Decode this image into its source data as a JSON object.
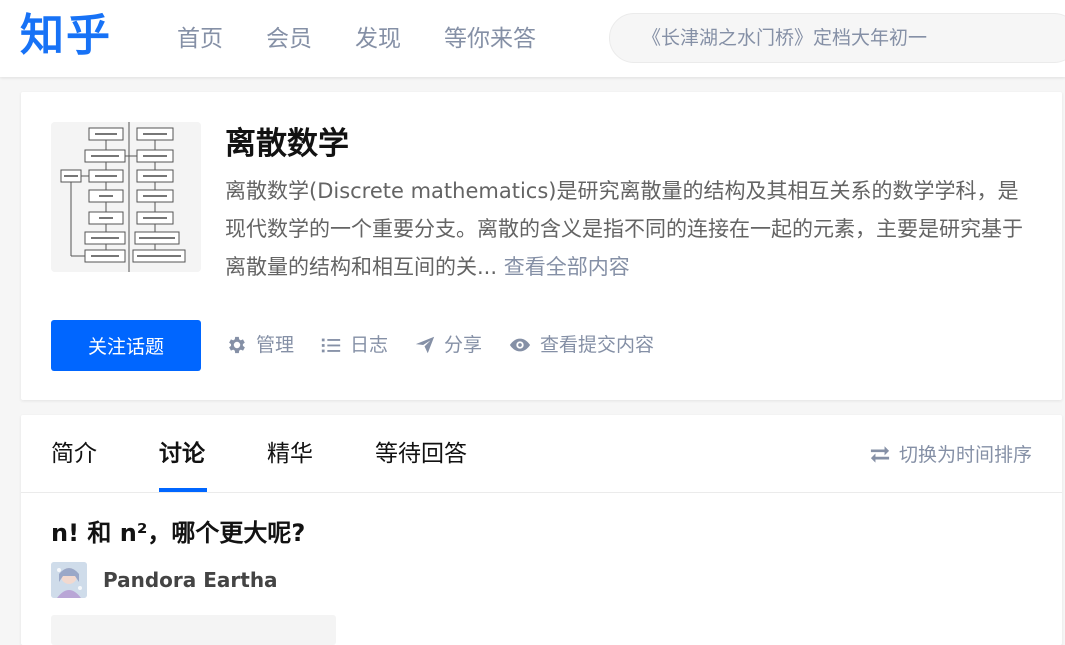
{
  "header": {
    "logo": "知乎",
    "nav": [
      "首页",
      "会员",
      "发现",
      "等你来答"
    ],
    "search_placeholder": "《长津湖之水门桥》定档大年初一"
  },
  "topic": {
    "title": "离散数学",
    "description": "离散数学(Discrete mathematics)是研究离散量的结构及其相互关系的数学学科，是现代数学的一个重要分支。离散的含义是指不同的连接在一起的元素，主要是研究基于离散量的结构和相互间的关...",
    "more_label": "查看全部内容",
    "follow_label": "关注话题",
    "actions": [
      {
        "icon": "gear-icon",
        "label": "管理"
      },
      {
        "icon": "list-icon",
        "label": "日志"
      },
      {
        "icon": "share-plane-icon",
        "label": "分享"
      },
      {
        "icon": "eye-icon",
        "label": "查看提交内容"
      }
    ]
  },
  "feed": {
    "tabs": [
      "简介",
      "讨论",
      "精华",
      "等待回答"
    ],
    "active_tab": "讨论",
    "sort_label": "切换为时间排序",
    "question_title": "n! 和 n²，哪个更大呢?",
    "author_name": "Pandora Eartha"
  },
  "colors": {
    "brand": "#1772f6",
    "primary_button": "#0066ff",
    "muted_text": "#8590a6"
  }
}
